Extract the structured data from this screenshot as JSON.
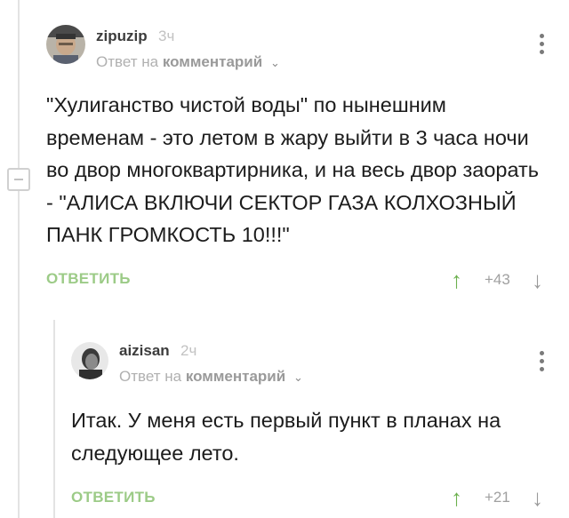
{
  "comments": [
    {
      "username": "zipuzip",
      "time": "3ч",
      "reply_prefix": "Ответ на",
      "reply_target": "комментарий",
      "text": "\"Хулиганство чистой воды\" по нынешним временам - это летом в жару выйти в 3 часа ночи во двор многоквартирника, и на весь двор заорать - \"АЛИСА ВКЛЮЧИ СЕКТОР ГАЗА КОЛХОЗНЫЙ ПАНК ГРОМКОСТЬ 10!!!\"",
      "reply_label": "ОТВЕТИТЬ",
      "rating": "+43"
    },
    {
      "username": "aizisan",
      "time": "2ч",
      "reply_prefix": "Ответ на",
      "reply_target": "комментарий",
      "text": "Итак. У меня есть первый пункт в планах на следующее лето.",
      "reply_label": "ОТВЕТИТЬ",
      "rating": "+21"
    }
  ],
  "colors": {
    "accent_green": "#6bb04d",
    "reply_green": "#9ccb87",
    "muted_gray": "#b0b0b0"
  },
  "icons": {
    "up": "arrow-up-icon",
    "down": "arrow-down-icon",
    "menu": "kebab-menu-icon",
    "collapse": "collapse-icon"
  }
}
